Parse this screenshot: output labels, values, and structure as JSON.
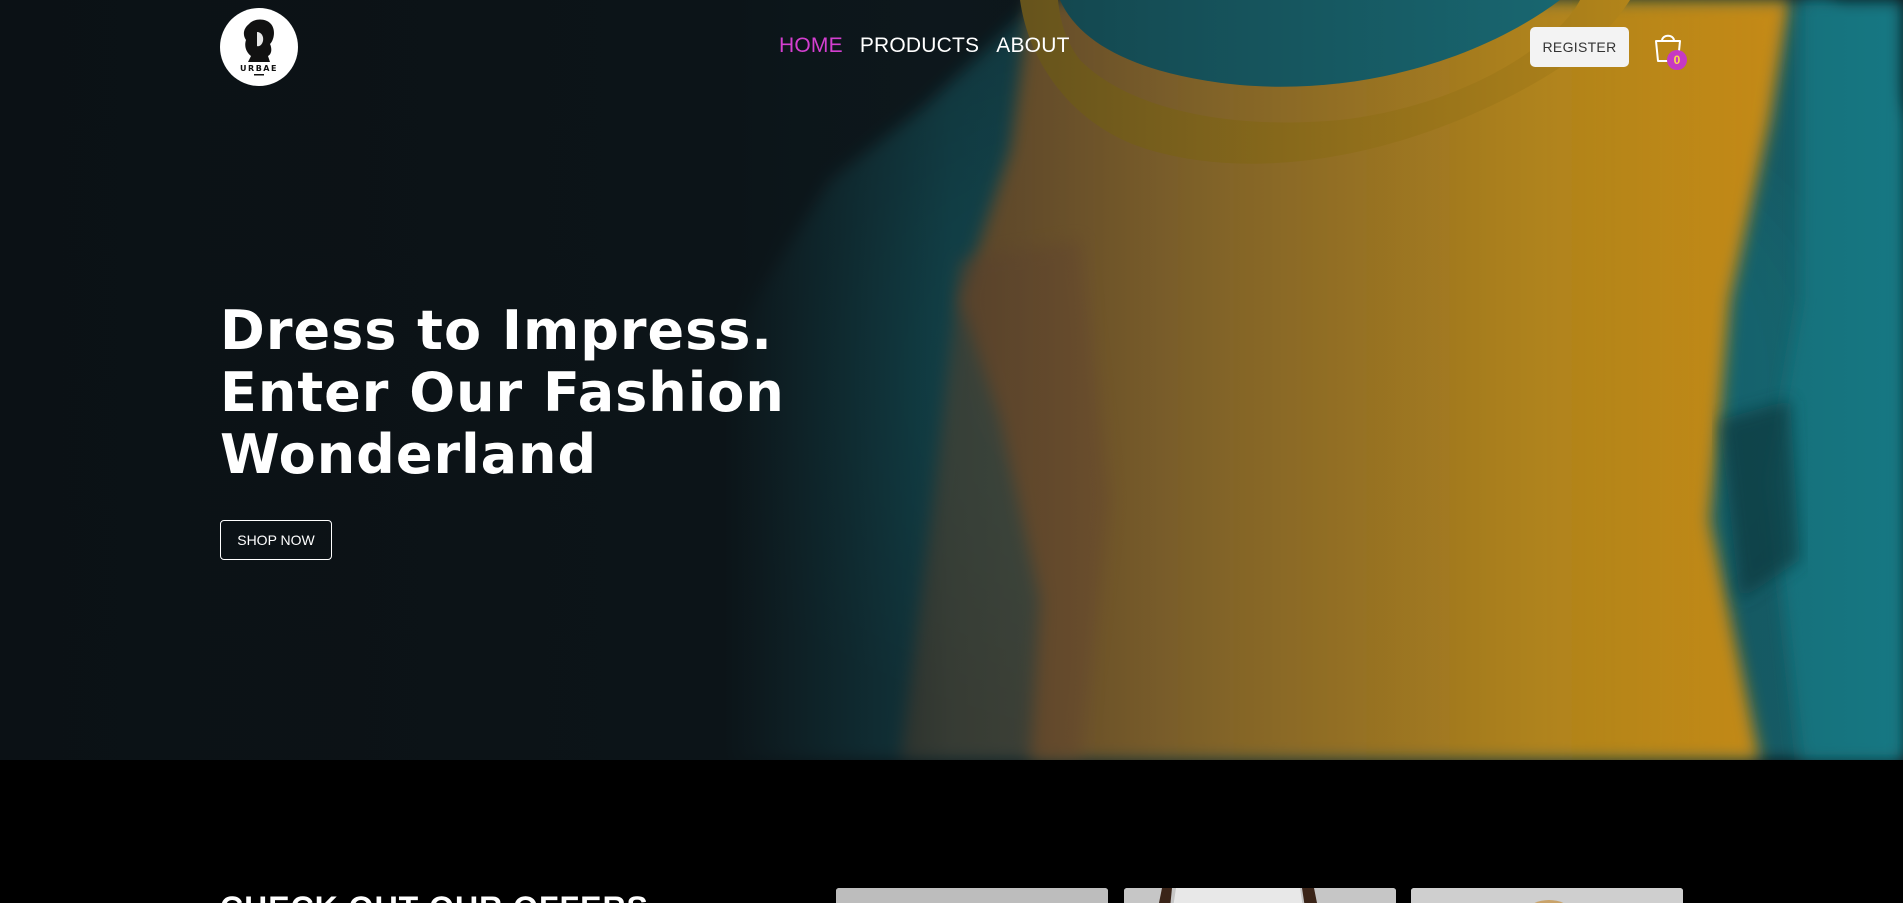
{
  "brand": {
    "logo_text": "URBAE"
  },
  "nav": {
    "items": [
      {
        "label": "HOME",
        "active": true
      },
      {
        "label": "PRODUCTS",
        "active": false
      },
      {
        "label": "ABOUT",
        "active": false
      }
    ]
  },
  "header": {
    "register_label": "REGISTER",
    "cart_count": "0"
  },
  "hero": {
    "title_lines": [
      "Dress to Impress.",
      "Enter Our Fashion",
      "Wonderland"
    ],
    "cta_label": "SHOP NOW"
  },
  "offers": {
    "title": "CHECK OUT OUR OFFERS"
  },
  "colors": {
    "accent": "#d43fd0",
    "badge_bg": "#c639c4",
    "badge_text": "#fde047",
    "hero_dark": "#0b1115",
    "shirt_yellow": "#e0a21a",
    "shirt_teal": "#1d8a96"
  },
  "icons": {
    "cart": "shopping-bag-icon",
    "logo": "statue-bust-logo"
  }
}
